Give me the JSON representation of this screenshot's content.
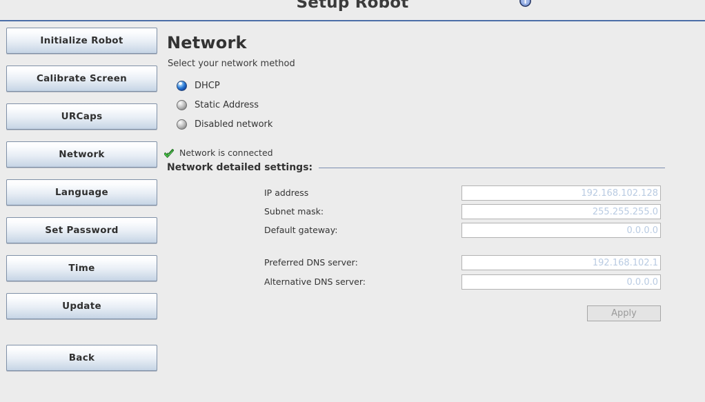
{
  "header": {
    "title": "Setup Robot",
    "info_icon": "info-icon"
  },
  "sidebar": {
    "items": [
      {
        "label": "Initialize Robot",
        "name": "initialize-robot"
      },
      {
        "label": "Calibrate Screen",
        "name": "calibrate-screen"
      },
      {
        "label": "URCaps",
        "name": "urcaps"
      },
      {
        "label": "Network",
        "name": "network"
      },
      {
        "label": "Language",
        "name": "language"
      },
      {
        "label": "Set Password",
        "name": "set-password"
      },
      {
        "label": "Time",
        "name": "time"
      },
      {
        "label": "Update",
        "name": "update"
      }
    ],
    "back_label": "Back"
  },
  "main": {
    "title": "Network",
    "subtitle": "Select your network method",
    "methods": [
      {
        "label": "DHCP",
        "selected": true
      },
      {
        "label": "Static Address",
        "selected": false
      },
      {
        "label": "Disabled network",
        "selected": false
      }
    ],
    "status": {
      "icon": "check-icon",
      "text": "Network is connected"
    },
    "section_label": "Network detailed settings:",
    "fields": [
      {
        "label": "IP address",
        "value": "192.168.102.128",
        "name": "ip-address"
      },
      {
        "label": "Subnet mask:",
        "value": "255.255.255.0",
        "name": "subnet-mask"
      },
      {
        "label": "Default gateway:",
        "value": "0.0.0.0",
        "name": "default-gateway"
      },
      {
        "label": "Preferred DNS server:",
        "value": "192.168.102.1",
        "name": "preferred-dns-server"
      },
      {
        "label": "Alternative DNS server:",
        "value": "0.0.0.0",
        "name": "alternative-dns-server"
      }
    ],
    "apply_label": "Apply"
  },
  "colors": {
    "background": "#ececec",
    "header_rule": "#4a6da7",
    "section_rule": "#7a8db0",
    "button_border": "#7e8fa6",
    "input_value": "#b9cbe2",
    "radio_selected": "#2f7fd8",
    "status_check": "#3fbf3f"
  }
}
